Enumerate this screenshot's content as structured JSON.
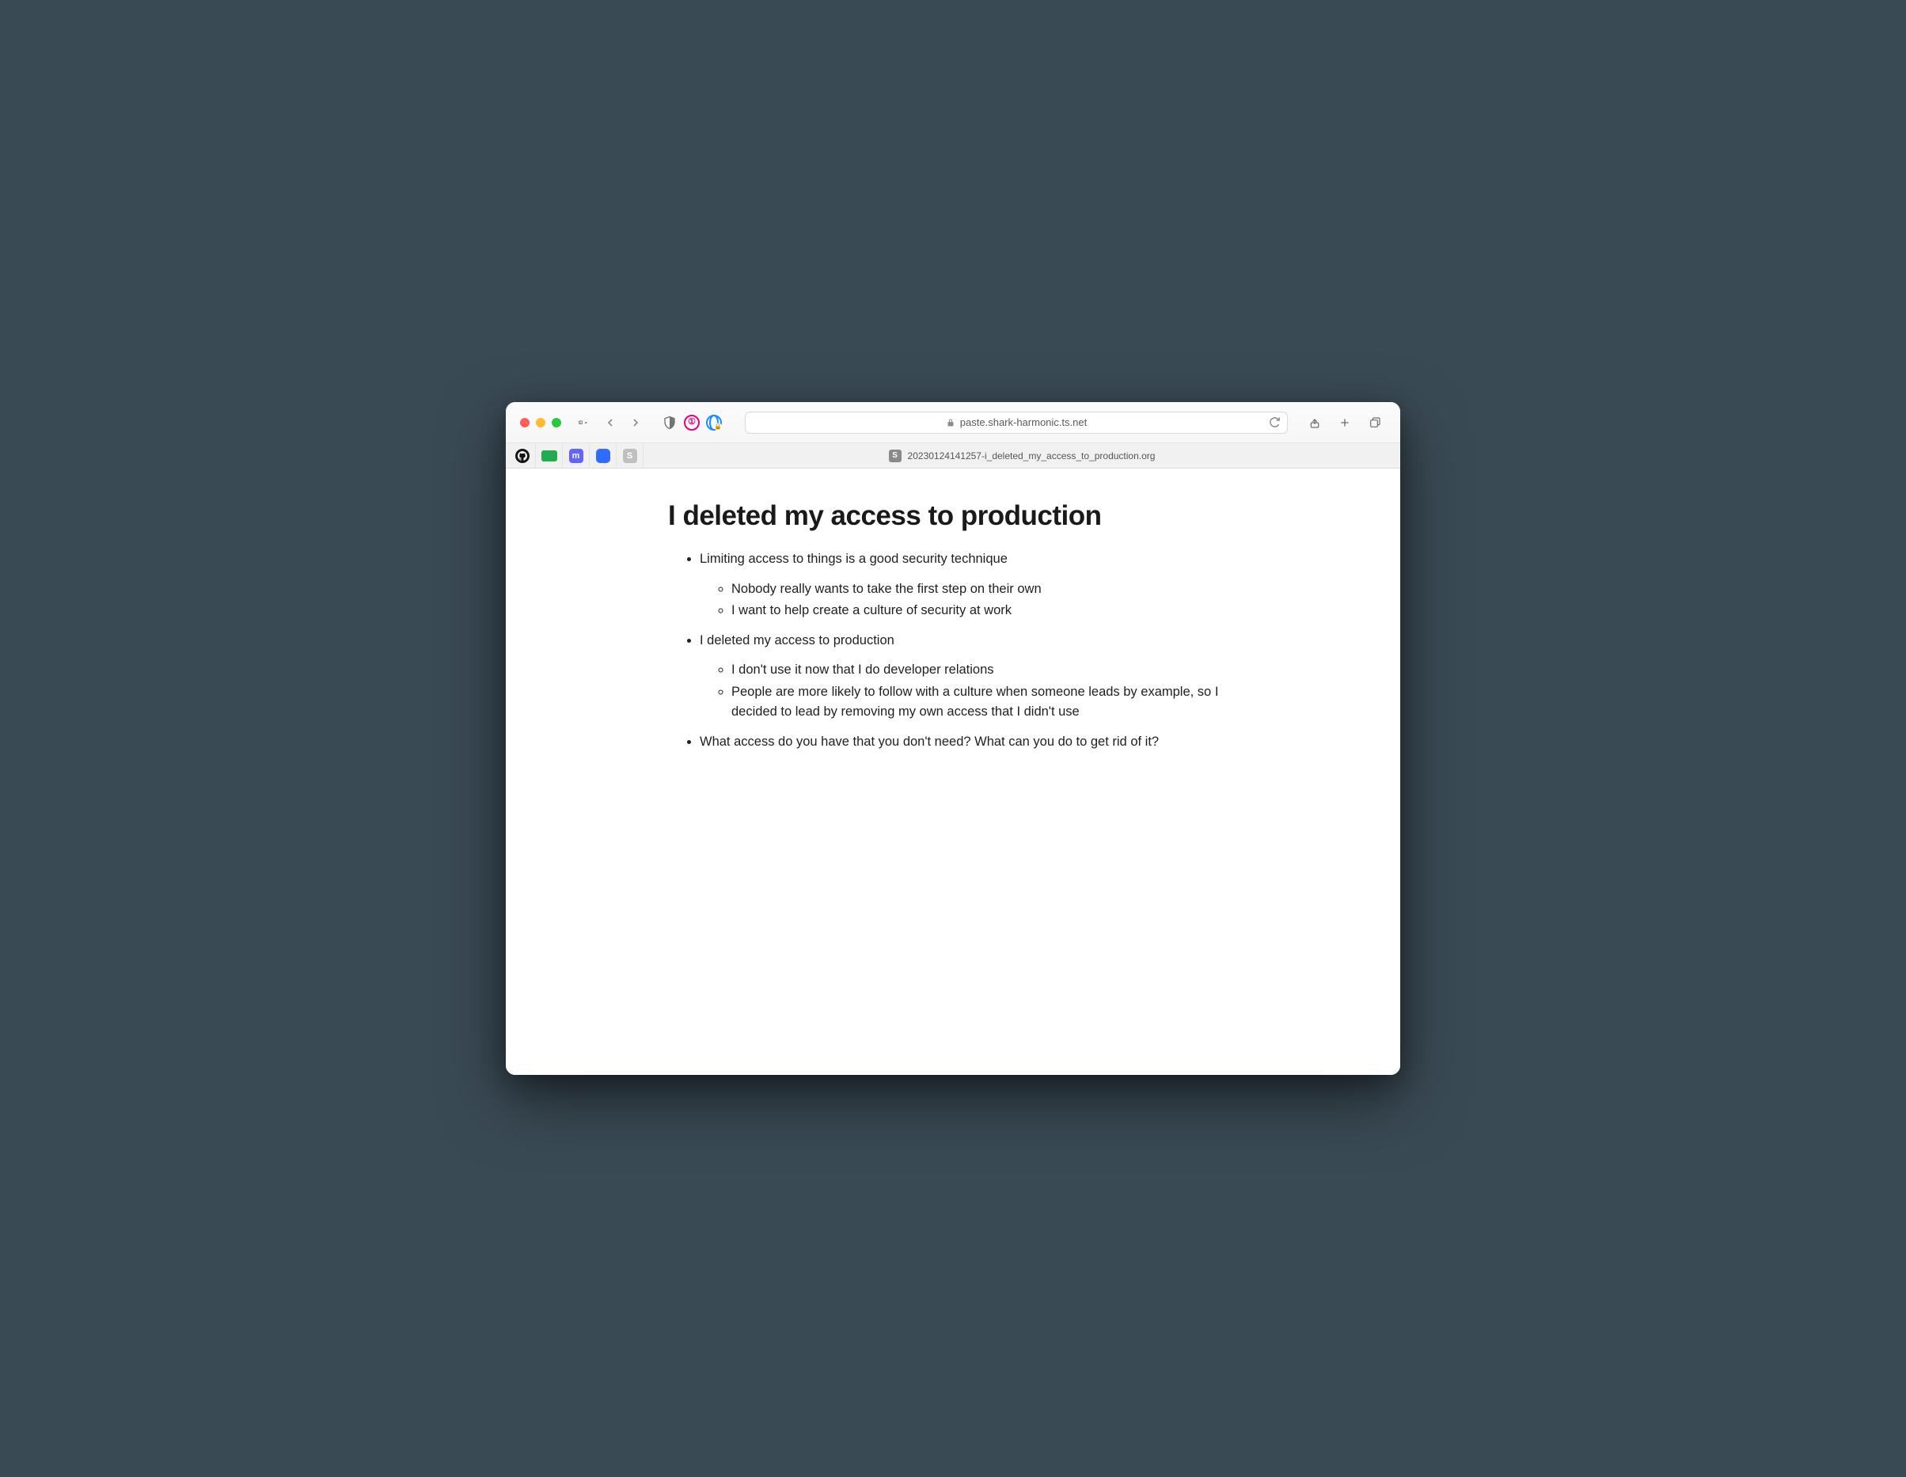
{
  "browser": {
    "url_display": "paste.shark-harmonic.ts.net",
    "tab_title": "20230124141257-i_deleted_my_access_to_production.org"
  },
  "document": {
    "title": "I deleted my access to production",
    "bullets": {
      "b1": "Limiting access to things is a good security technique",
      "b1_children": {
        "c1": "Nobody really wants to take the first step on their own",
        "c2": "I want to help create a culture of security at work"
      },
      "b2": "I deleted my access to production",
      "b2_children": {
        "c1": "I don't use it now that I do developer relations",
        "c2": "People are more likely to follow with a culture when someone leads by example, so I decided to lead by removing my own access that I didn't use"
      },
      "b3": "What access do you have that you don't need? What can you do to get rid of it?"
    }
  }
}
